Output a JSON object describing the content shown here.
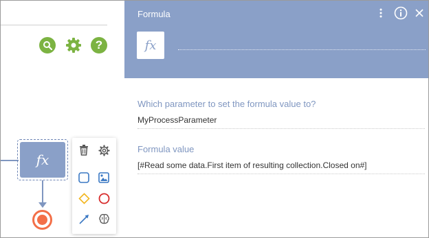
{
  "panel": {
    "title": "Formula",
    "fx_symbol": "fx",
    "name_value": "",
    "fields": [
      {
        "label": "Which parameter to set the formula value to?",
        "value": "MyProcessParameter"
      },
      {
        "label": "Formula value",
        "value": "[#Read some data.First item of resulting collection.Closed on#]"
      }
    ]
  },
  "canvas": {
    "toolbar_icons": [
      "search-icon",
      "gear-icon",
      "help-icon"
    ],
    "selected_node_symbol": "fx",
    "palette_icons": [
      "trash-icon",
      "gear-icon",
      "task-square-icon",
      "image-task-icon",
      "gateway-diamond-icon",
      "end-event-circle-icon",
      "connector-arrow-icon",
      "brain-icon"
    ]
  },
  "colors": {
    "panel_header": "#8aa0c8",
    "label_blue": "#7f96c0",
    "toolbar_green": "#7cb342",
    "end_event": "#f36f48",
    "gateway": "#f2b51c",
    "palette_blue": "#3a78c3",
    "palette_red": "#d72b2b"
  }
}
